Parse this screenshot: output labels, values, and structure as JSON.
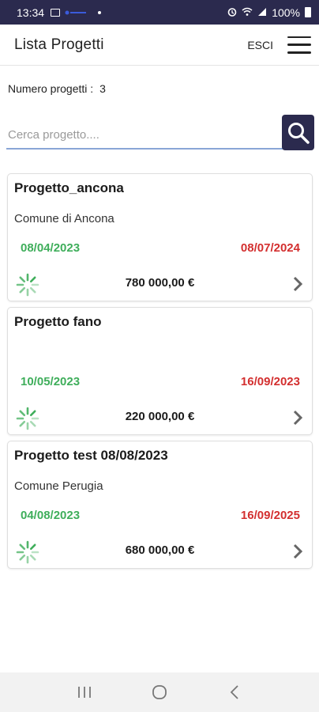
{
  "status_bar": {
    "time": "13:34",
    "battery": "100%",
    "icons": [
      "image-icon",
      "app-notification-icon",
      "dot-icon",
      "alarm-icon",
      "wifi-icon",
      "signal-icon",
      "battery-icon"
    ]
  },
  "header": {
    "title": "Lista Progetti",
    "logout_label": "ESCI",
    "menu_icon": "hamburger-menu-icon"
  },
  "summary": {
    "count_label": "Numero progetti :",
    "count_value": "3"
  },
  "search": {
    "placeholder": "Cerca progetto....",
    "value": "",
    "icon": "search-icon"
  },
  "projects": [
    {
      "name": "Progetto_ancona",
      "comune": "Comune di Ancona",
      "start_date": "08/04/2023",
      "end_date": "08/07/2024",
      "amount": "780 000,00 €"
    },
    {
      "name": "Progetto fano",
      "comune": "",
      "start_date": "10/05/2023",
      "end_date": "16/09/2023",
      "amount": "220 000,00 €"
    },
    {
      "name": "Progetto test 08/08/2023",
      "comune": "Comune Perugia",
      "start_date": "04/08/2023",
      "end_date": "16/09/2025",
      "amount": "680 000,00 €"
    }
  ],
  "colors": {
    "primary": "#2b2a4e",
    "start_date": "#3fae5b",
    "end_date": "#d32f2f",
    "spinner": "#3fae5b",
    "search_underline": "#8aa6d6"
  },
  "nav": [
    "recent-apps-icon",
    "home-icon",
    "back-icon"
  ]
}
